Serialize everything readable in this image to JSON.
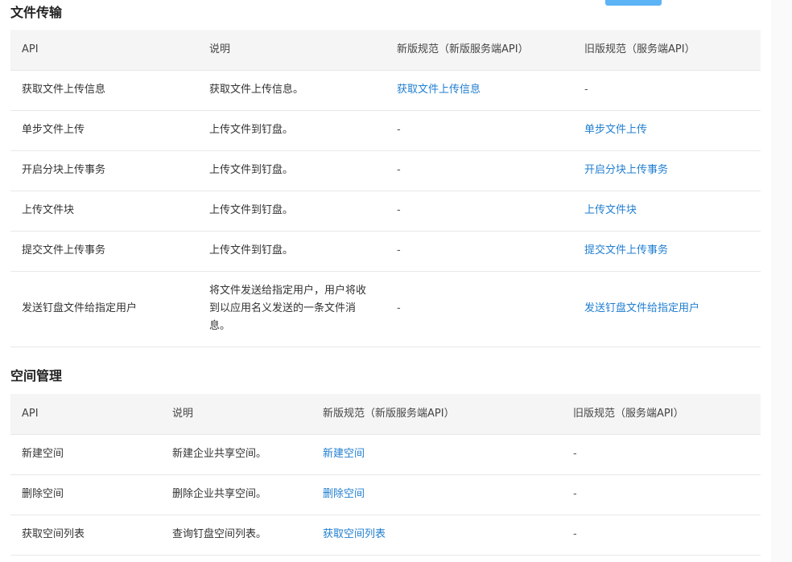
{
  "file_transfer": {
    "title": "文件传输",
    "headers": [
      "API",
      "说明",
      "新版规范（新版服务端API）",
      "旧版规范（服务端API）"
    ],
    "rows": [
      {
        "api": "获取文件上传信息",
        "desc": "获取文件上传信息。",
        "new": "获取文件上传信息",
        "old": "-"
      },
      {
        "api": "单步文件上传",
        "desc": "上传文件到钉盘。",
        "new": "-",
        "old": "单步文件上传"
      },
      {
        "api": "开启分块上传事务",
        "desc": "上传文件到钉盘。",
        "new": "-",
        "old": "开启分块上传事务"
      },
      {
        "api": "上传文件块",
        "desc": "上传文件到钉盘。",
        "new": "-",
        "old": "上传文件块"
      },
      {
        "api": "提交文件上传事务",
        "desc": "上传文件到钉盘。",
        "new": "-",
        "old": "提交文件上传事务"
      },
      {
        "api": "发送钉盘文件给指定用户",
        "desc": "将文件发送给指定用户，用户将收到以应用名义发送的一条文件消息。",
        "new": "-",
        "old": "发送钉盘文件给指定用户"
      }
    ]
  },
  "space_management": {
    "title": "空间管理",
    "headers": [
      "API",
      "说明",
      "新版规范（新版服务端API）",
      "旧版规范（服务端API）"
    ],
    "rows": [
      {
        "api": "新建空间",
        "desc": "新建企业共享空间。",
        "new": "新建空间",
        "old": "-"
      },
      {
        "api": "删除空间",
        "desc": "删除企业共享空间。",
        "new": "删除空间",
        "old": "-"
      },
      {
        "api": "获取空间列表",
        "desc": "查询钉盘空间列表。",
        "new": "获取空间列表",
        "old": "-"
      }
    ]
  },
  "colors": {
    "link": "#1f7ed0",
    "header_bg": "#f5f5f5",
    "border": "#e8e8e8",
    "top_button": "#5cb3f5"
  }
}
